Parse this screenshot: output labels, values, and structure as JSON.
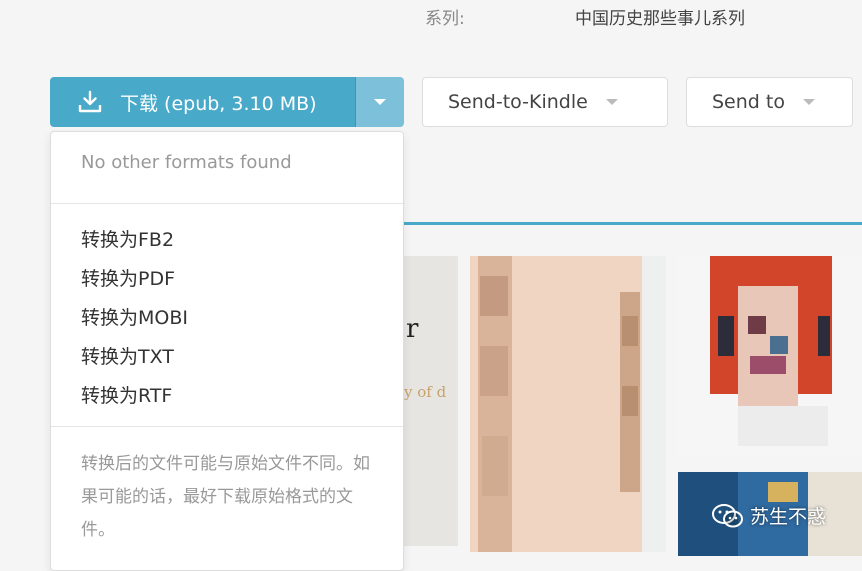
{
  "series": {
    "label": "系列:",
    "value": "中国历史那些事儿系列"
  },
  "download": {
    "label": "下载 (epub, 3.10 MB)",
    "icon": "download-icon",
    "color": "#49a9c9",
    "caret_color": "#7cc1d9"
  },
  "send_to_kindle": {
    "label": "Send-to-Kindle"
  },
  "send_to": {
    "label": "Send to"
  },
  "dropdown": {
    "header": "No other formats found",
    "items": [
      {
        "label": "转换为FB2"
      },
      {
        "label": "转换为PDF"
      },
      {
        "label": "转换为MOBI"
      },
      {
        "label": "转换为TXT"
      },
      {
        "label": "转换为RTF"
      }
    ],
    "note": "转换后的文件可能与原始文件不同。如果可能的话，最好下载原始格式的文件。"
  },
  "covers": {
    "cover1_title": "r",
    "cover1_subtitle": "y of d"
  },
  "watermark": {
    "text": "苏生不惑",
    "icon": "wechat-icon"
  },
  "accent_color": "#49a9c9"
}
